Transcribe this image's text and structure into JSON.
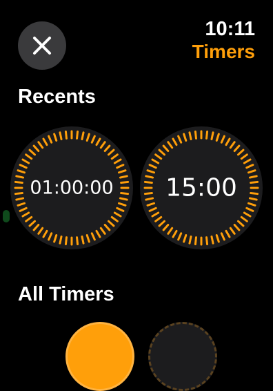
{
  "status": {
    "time": "10:11",
    "app_title": "Timers"
  },
  "close_button": {
    "icon": "close-icon"
  },
  "sections": {
    "recents": "Recents",
    "all_timers": "All Timers"
  },
  "recents": [
    {
      "label": "01:00:00"
    },
    {
      "label": "15:00"
    }
  ],
  "colors": {
    "accent": "#ff9f0a",
    "card": "#1c1c1e",
    "button": "#3a3a3c"
  }
}
